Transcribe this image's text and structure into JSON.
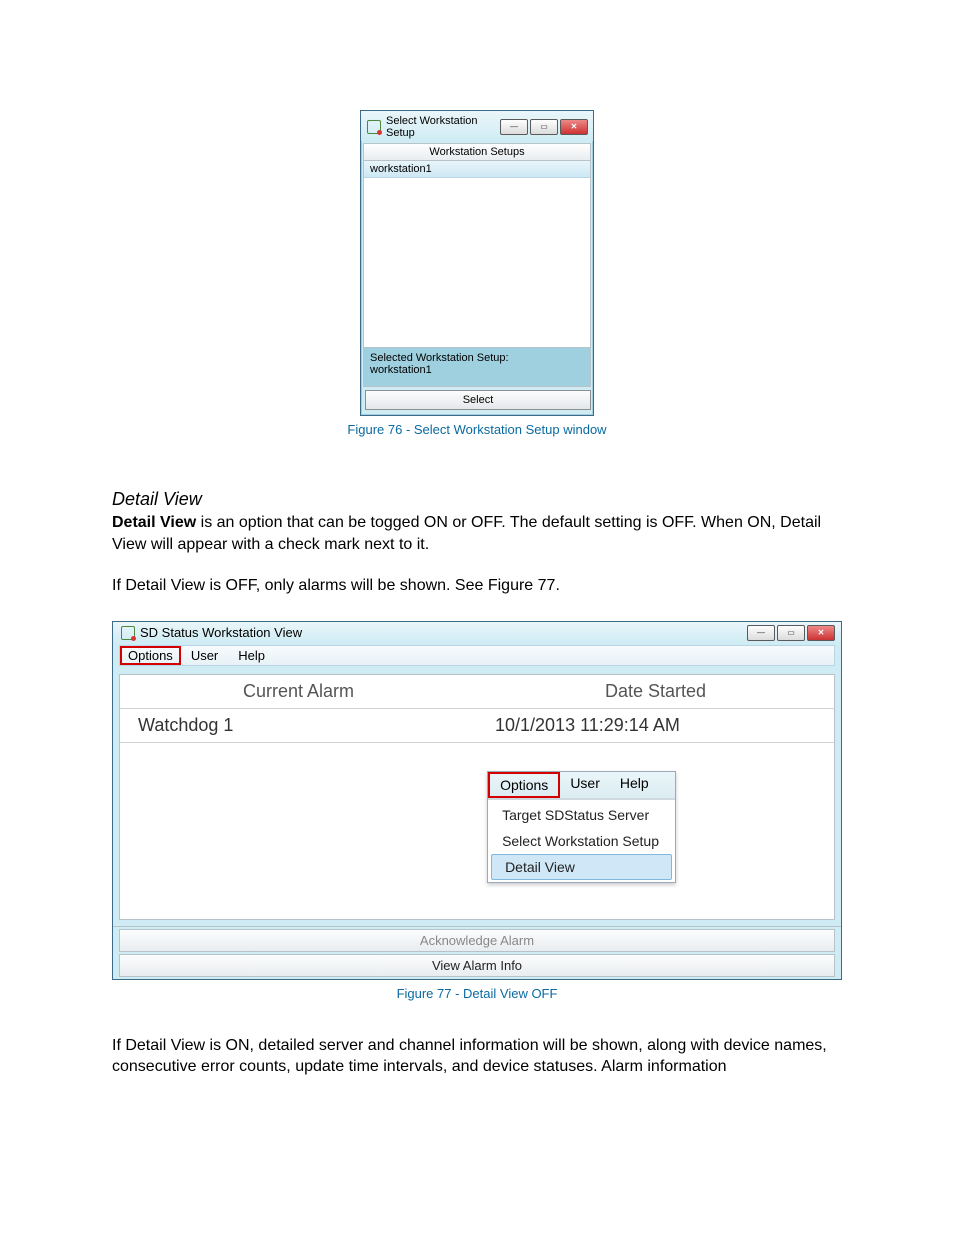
{
  "win1": {
    "title": "Select Workstation Setup",
    "header": "Workstation Setups",
    "items": [
      "workstation1"
    ],
    "selected_label": "Selected Workstation Setup:",
    "selected_value": "workstation1",
    "select_button": "Select"
  },
  "captions": {
    "fig76": "Figure 76 - Select Workstation Setup window",
    "fig77": "Figure 77 - Detail View OFF"
  },
  "section": {
    "heading": "Detail View",
    "para1_prefix": "Detail View",
    "para1_rest": " is an option that can be togged ON or OFF. The default setting is OFF. When ON, Detail View will appear with a check mark next to it.",
    "para2": "If Detail View is OFF, only alarms will be shown. See Figure 77."
  },
  "win2": {
    "title": "SD Status Workstation View",
    "menu": {
      "options": "Options",
      "user": "User",
      "help": "Help"
    },
    "table": {
      "col1": "Current Alarm",
      "col2": "Date Started",
      "row1_c1": "Watchdog 1",
      "row1_c2": "10/1/2013 11:29:14 AM"
    },
    "popup": {
      "options": "Options",
      "user": "User",
      "help": "Help",
      "i1": "Target SDStatus Server",
      "i2": "Select Workstation Setup",
      "i3": "Detail View"
    },
    "ack": "Acknowledge Alarm",
    "view": "View Alarm Info"
  },
  "tail": "If Detail View is ON, detailed server and channel information will be shown, along with device names, consecutive error counts, update time intervals, and device statuses. Alarm information"
}
